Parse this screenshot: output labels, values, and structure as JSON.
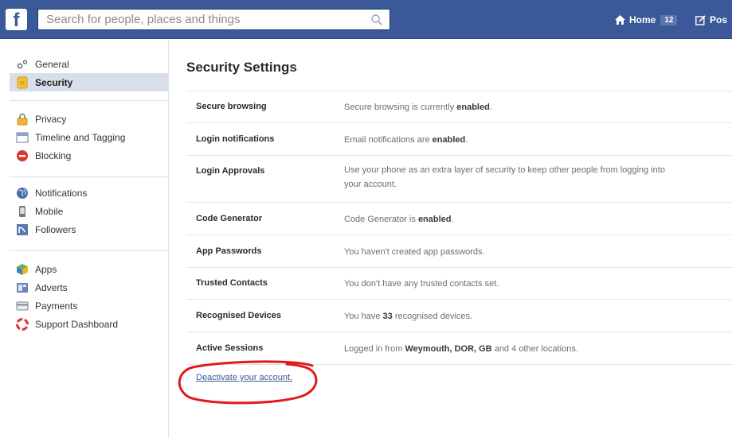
{
  "topbar": {
    "logo_text": "f",
    "search_placeholder": "Search for people, places and things",
    "home_label": "Home",
    "home_count": "12",
    "post_label": "Pos"
  },
  "sidebar": {
    "groups": [
      [
        {
          "label": "General",
          "icon": "general-icon",
          "selected": false
        },
        {
          "label": "Security",
          "icon": "security-icon",
          "selected": true
        }
      ],
      [
        {
          "label": "Privacy",
          "icon": "privacy-icon"
        },
        {
          "label": "Timeline and Tagging",
          "icon": "timeline-icon"
        },
        {
          "label": "Blocking",
          "icon": "blocking-icon"
        }
      ],
      [
        {
          "label": "Notifications",
          "icon": "globe-icon"
        },
        {
          "label": "Mobile",
          "icon": "mobile-icon"
        },
        {
          "label": "Followers",
          "icon": "followers-icon"
        }
      ],
      [
        {
          "label": "Apps",
          "icon": "apps-icon"
        },
        {
          "label": "Adverts",
          "icon": "adverts-icon"
        },
        {
          "label": "Payments",
          "icon": "payments-icon"
        },
        {
          "label": "Support Dashboard",
          "icon": "support-icon"
        }
      ]
    ]
  },
  "main": {
    "title": "Security Settings",
    "rows": [
      {
        "label": "Secure browsing",
        "desc_pre": "Secure browsing is currently ",
        "desc_bold": "enabled",
        "desc_post": "."
      },
      {
        "label": "Login notifications",
        "desc_pre": "Email notifications are ",
        "desc_bold": "enabled",
        "desc_post": "."
      },
      {
        "label": "Login Approvals",
        "desc_line1": "Use your phone as an extra layer of security to keep other people from logging into",
        "desc_line2": "your account."
      },
      {
        "label": "Code Generator",
        "desc_pre": "Code Generator is ",
        "desc_bold": "enabled",
        "desc_post": "."
      },
      {
        "label": "App Passwords",
        "desc_pre": "You haven't created app passwords.",
        "desc_bold": "",
        "desc_post": ""
      },
      {
        "label": "Trusted Contacts",
        "desc_pre": "You don't have any trusted contacts set.",
        "desc_bold": "",
        "desc_post": ""
      },
      {
        "label": "Recognised Devices",
        "desc_pre": "You have ",
        "desc_bold": "33",
        "desc_post": " recognised devices."
      },
      {
        "label": "Active Sessions",
        "desc_pre": "Logged in from ",
        "desc_bold": "Weymouth, DOR, GB",
        "desc_post": " and 4 other locations."
      }
    ],
    "deactivate_link": "Deactivate your account."
  },
  "colors": {
    "topbar": "#3b5998",
    "selected_bg": "#d8dfea",
    "annotation": "#e0191c"
  }
}
